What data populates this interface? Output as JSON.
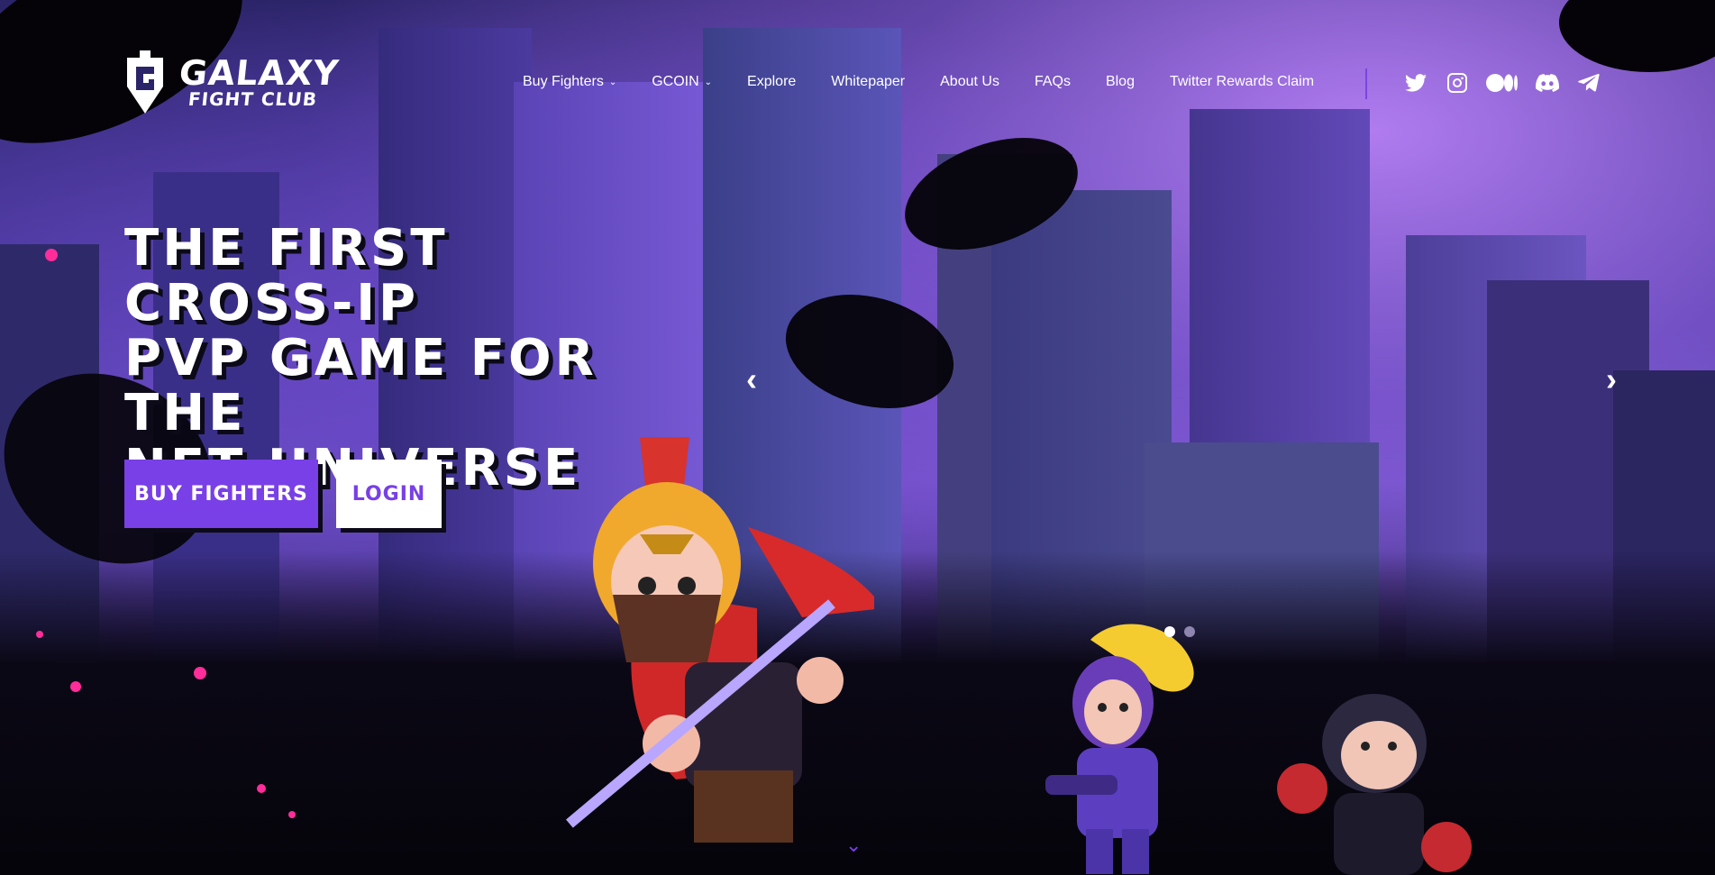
{
  "brand": {
    "line1": "GALAXY",
    "line2": "FIGHT CLUB"
  },
  "nav": {
    "items": [
      {
        "label": "Buy Fighters",
        "dropdown": true
      },
      {
        "label": "GCOIN",
        "dropdown": true
      },
      {
        "label": "Explore",
        "dropdown": false
      },
      {
        "label": "Whitepaper",
        "dropdown": false
      },
      {
        "label": "About Us",
        "dropdown": false
      },
      {
        "label": "FAQs",
        "dropdown": false
      },
      {
        "label": "Blog",
        "dropdown": false
      },
      {
        "label": "Twitter Rewards Claim",
        "dropdown": false
      }
    ],
    "social": [
      "twitter-icon",
      "instagram-icon",
      "medium-icon",
      "discord-icon",
      "telegram-icon"
    ]
  },
  "hero": {
    "title_line1": "THE FIRST CROSS-IP",
    "title_line2": "PVP GAME FOR THE",
    "title_line3": "NFT UNIVERSE",
    "buy_label": "BUY FIGHTERS",
    "login_label": "LOGIN"
  },
  "carousel": {
    "active_slide": 1,
    "slide_count": 2
  },
  "colors": {
    "accent": "#7840e6",
    "splash": "#ff2d9a",
    "text": "#ffffff"
  }
}
